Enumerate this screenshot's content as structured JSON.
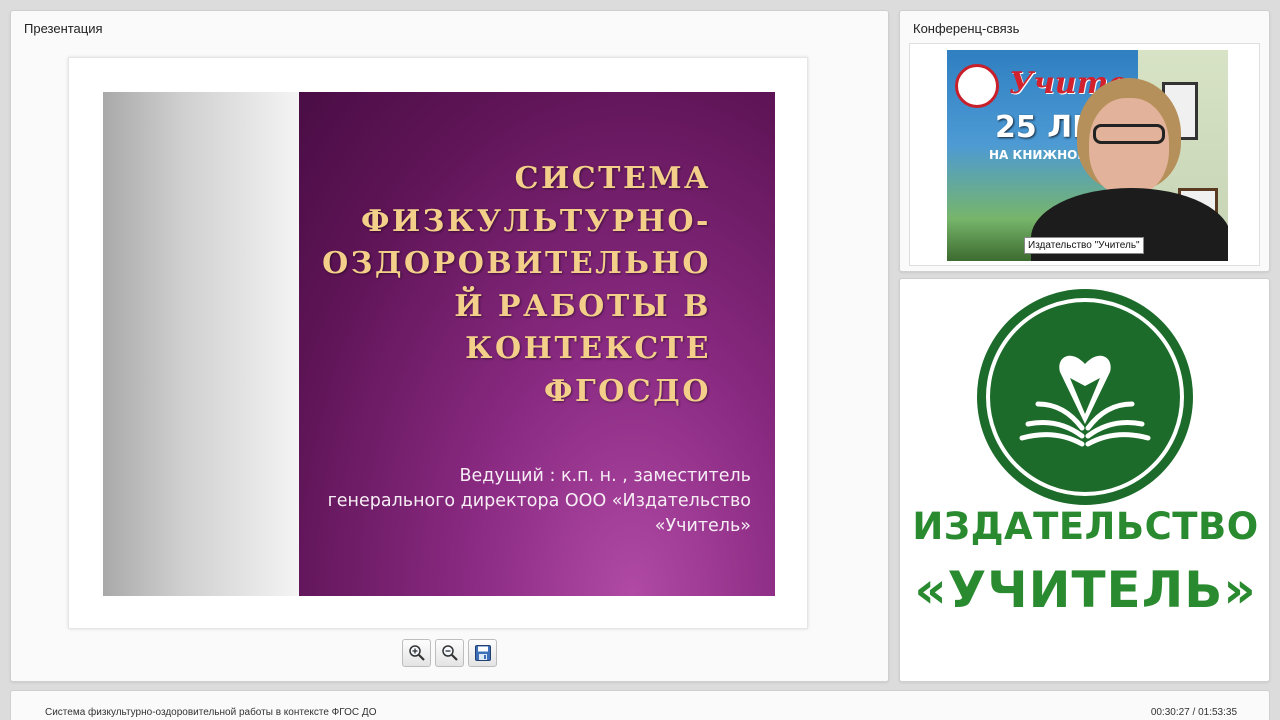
{
  "presentation": {
    "panel_title": "Презентация",
    "slide": {
      "title": "СИСТЕМА\nФИЗКУЛЬТУРНО-\nОЗДОРОВИТЕЛЬНО\nЙ РАБОТЫ В\nКОНТЕКСТЕ\nФГОСДО",
      "subtitle": "Ведущий : к.п. н. , заместитель\nгенерального директора ООО «Издательство\n«Учитель»"
    },
    "toolbar": {
      "icons": [
        "zoom-in-icon",
        "zoom-out-icon",
        "save-icon"
      ]
    }
  },
  "conference": {
    "panel_title": "Конференц-связь",
    "video_label": "Издательство \"Учитель\"",
    "video_banner": {
      "brand": "Учите",
      "years": "25 ЛЕТ",
      "subline": "НА КНИЖНОМ Р   РОСС"
    }
  },
  "logo": {
    "line1": "ИЗДАТЕЛЬСТВО",
    "line2": "«УЧИТЕЛЬ»",
    "color": "#2a8a2f"
  },
  "bottom": {
    "title": "Система физкультурно-оздоровительной работы в контексте ФГОС ДО",
    "time": "00:30:27 / 01:53:35"
  }
}
